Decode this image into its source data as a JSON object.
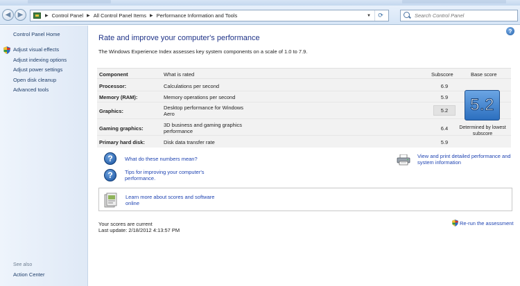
{
  "colors": {
    "accent": "#1e3287",
    "link": "#1e43b2",
    "left_pane_link": "#1f3e6a",
    "score_box": "#2c6fbf"
  },
  "address_bar": {
    "flag_icon": "control-panel-icon",
    "breadcrumbs": [
      "Control Panel",
      "All Control Panel Items",
      "Performance Information and Tools"
    ]
  },
  "search": {
    "placeholder": "Search Control Panel"
  },
  "left_pane": {
    "home": "Control Panel Home",
    "links": [
      "Adjust visual effects",
      "Adjust indexing options",
      "Adjust power settings",
      "Open disk cleanup",
      "Advanced tools"
    ],
    "see_also_label": "See also",
    "see_also_links": [
      "Action Center"
    ]
  },
  "main": {
    "title": "Rate and improve your computer's performance",
    "intro": "The Windows Experience Index assesses key system components on a scale of 1.0 to 7.9.",
    "table": {
      "headers": {
        "component": "Component",
        "what": "What is rated",
        "subscore": "Subscore",
        "base": "Base score"
      },
      "rows": [
        {
          "component": "Processor:",
          "what": "Calculations per second",
          "subscore": "6.9"
        },
        {
          "component": "Memory (RAM):",
          "what": "Memory operations per second",
          "subscore": "5.9"
        },
        {
          "component": "Graphics:",
          "what": "Desktop performance for Windows Aero",
          "subscore": "5.2"
        },
        {
          "component": "Gaming graphics:",
          "what": "3D business and gaming graphics performance",
          "subscore": "6.4"
        },
        {
          "component": "Primary hard disk:",
          "what": "Disk data transfer rate",
          "subscore": "5.9"
        }
      ],
      "base_score": "5.2",
      "base_caption": "Determined by lowest subscore"
    },
    "links": {
      "numbers": "What do these numbers mean?",
      "tips": "Tips for improving your computer's performance.",
      "print": "View and print detailed performance and system information",
      "learn": "Learn more about scores and software online",
      "rerun": "Re-run the assessment"
    },
    "status": {
      "current": "Your scores are current",
      "last_update": "Last update: 2/18/2012 4:13:57 PM"
    }
  }
}
